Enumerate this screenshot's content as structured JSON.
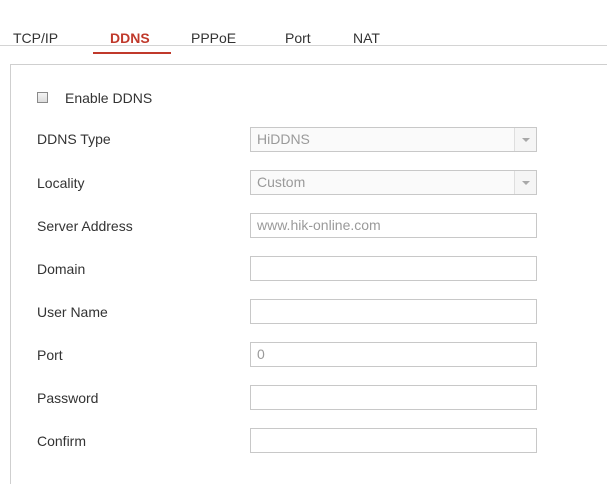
{
  "tabs": [
    {
      "label": "TCP/IP",
      "active": false
    },
    {
      "label": "DDNS",
      "active": true
    },
    {
      "label": "PPPoE",
      "active": false
    },
    {
      "label": "Port",
      "active": false
    },
    {
      "label": "NAT",
      "active": false
    }
  ],
  "enable_ddns": {
    "label": "Enable DDNS",
    "checked": false
  },
  "form": {
    "ddns_type": {
      "label": "DDNS Type",
      "value": "HiDDNS"
    },
    "locality": {
      "label": "Locality",
      "value": "Custom"
    },
    "server_address": {
      "label": "Server Address",
      "value": "www.hik-online.com"
    },
    "domain": {
      "label": "Domain",
      "value": ""
    },
    "user_name": {
      "label": "User Name",
      "value": ""
    },
    "port": {
      "label": "Port",
      "value": "0"
    },
    "password": {
      "label": "Password",
      "value": ""
    },
    "confirm": {
      "label": "Confirm",
      "value": ""
    }
  },
  "colors": {
    "accent": "#c0392b",
    "border": "#c8c8c8",
    "disabled_text": "#9a9a9a"
  },
  "icons": {
    "dropdown": "chevron-down-icon",
    "checkbox": "checkbox-unchecked-icon"
  }
}
